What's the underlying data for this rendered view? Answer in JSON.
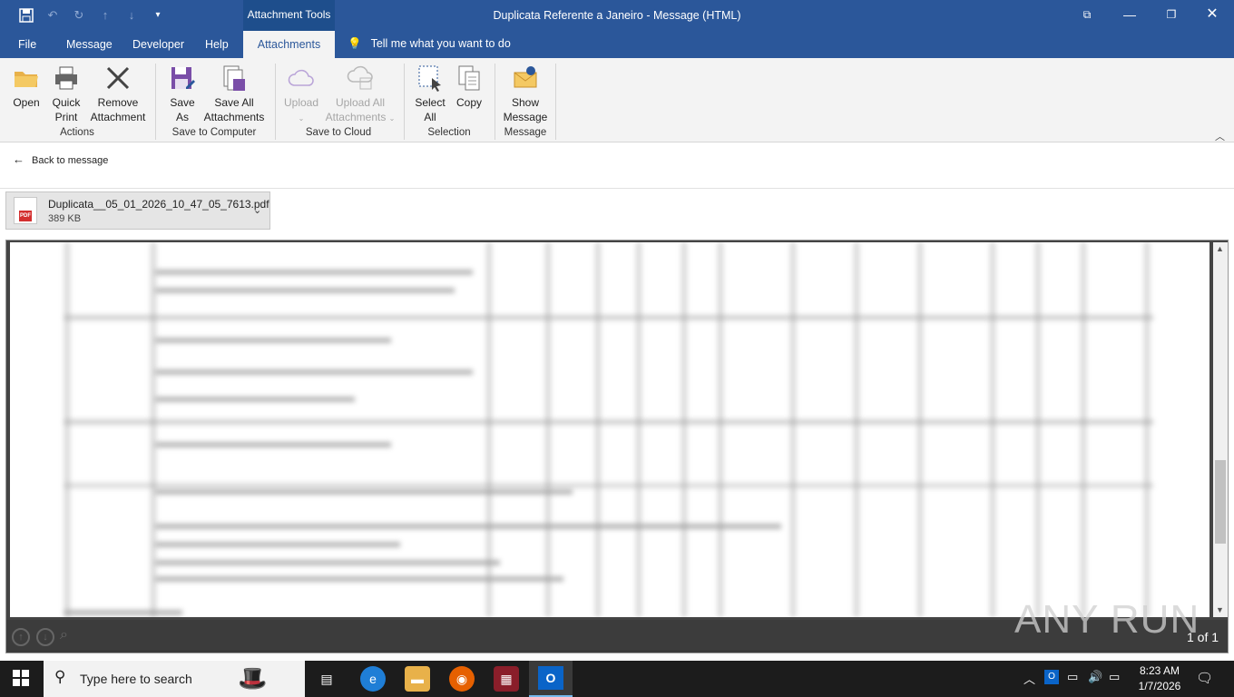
{
  "window": {
    "title": "Duplicata Referente a Janeiro  -  Message (HTML)",
    "context_tab": "Attachment Tools"
  },
  "tabs": [
    "File",
    "Message",
    "Developer",
    "Help",
    "Attachments"
  ],
  "tell_me": "Tell me what you want to do",
  "ribbon": {
    "actions": {
      "open": "Open",
      "quick_print": [
        "Quick",
        "Print"
      ],
      "remove": [
        "Remove",
        "Attachment"
      ],
      "label": "Actions"
    },
    "save_computer": {
      "save_as": [
        "Save",
        "As"
      ],
      "save_all": [
        "Save All",
        "Attachments"
      ],
      "label": "Save to Computer"
    },
    "save_cloud": {
      "upload": "Upload",
      "upload_all": [
        "Upload All",
        "Attachments"
      ],
      "label": "Save to Cloud"
    },
    "selection": {
      "select_all": [
        "Select",
        "All"
      ],
      "copy": "Copy",
      "label": "Selection"
    },
    "message": {
      "show": [
        "Show",
        "Message"
      ],
      "label": "Message"
    }
  },
  "back_link": "Back to message",
  "attachment": {
    "name": "Duplicata__05_01_2026_10_47_05_7613.pdf",
    "size": "389 KB",
    "icon_text": "PDF"
  },
  "preview": {
    "page_count": "1 of 1",
    "watermark": "ANY RUN"
  },
  "taskbar": {
    "search_placeholder": "Type here to search",
    "time": "8:23 AM",
    "date": "1/7/2026"
  },
  "colors": {
    "accent": "#2b579a",
    "ribbon_bg": "#f3f3f3",
    "taskbar": "#1c1c1c"
  }
}
